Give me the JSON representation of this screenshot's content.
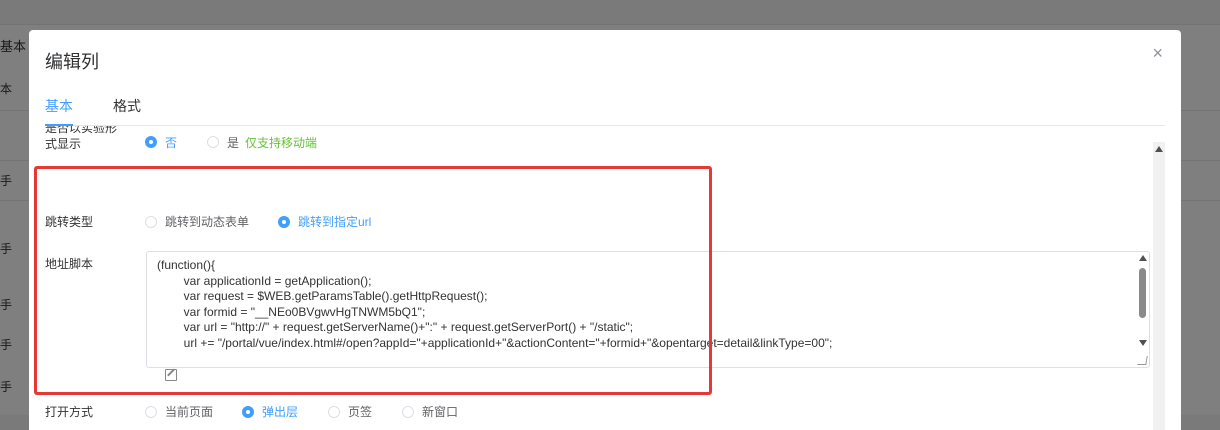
{
  "background": {
    "tab_label": "基本",
    "row_label": "本",
    "cell_text": "手"
  },
  "dialog": {
    "title": "编辑列",
    "close_glyph": "×",
    "tabs": [
      {
        "label": "基本",
        "active": true
      },
      {
        "label": "格式",
        "active": false
      }
    ]
  },
  "form": {
    "partial_row": {
      "label_line1": "是否以实验形",
      "label_line2": "式显示",
      "options": [
        {
          "label": "否",
          "checked": true
        },
        {
          "label": "是",
          "checked": false
        }
      ],
      "hint": "仅支持移动端"
    },
    "jump_type": {
      "label": "跳转类型",
      "options": [
        {
          "label": "跳转到动态表单",
          "checked": false
        },
        {
          "label": "跳转到指定url",
          "checked": true
        }
      ]
    },
    "address_script": {
      "label": "地址脚本",
      "code": "(function(){\n        var applicationId = getApplication();\n        var request = $WEB.getParamsTable().getHttpRequest();\n        var formid = \"__NEo0BVgwvHgTNWM5bQ1\";\n        var url = \"http://\" + request.getServerName()+\":\" + request.getServerPort() + \"/static\";\n        url += \"/portal/vue/index.html#/open?appId=\"+applicationId+\"&actionContent=\"+formid+\"&opentarget=detail&linkType=00\";"
    },
    "open_mode": {
      "label": "打开方式",
      "options": [
        {
          "label": "当前页面",
          "checked": false
        },
        {
          "label": "弹出层",
          "checked": true
        },
        {
          "label": "页签",
          "checked": false
        },
        {
          "label": "新窗口",
          "checked": false
        }
      ]
    }
  },
  "colors": {
    "accent": "#409eff",
    "highlight": "#e53935",
    "hint": "#67c23a"
  },
  "icons": {
    "close": "close-icon",
    "edit": "edit-icon"
  }
}
